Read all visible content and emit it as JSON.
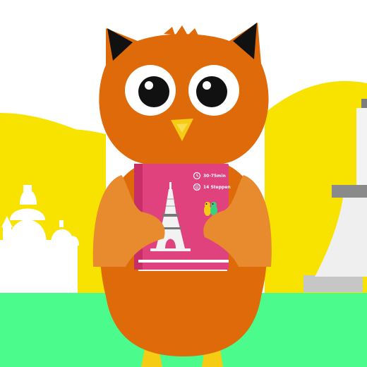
{
  "colors": {
    "sky": "#ffffff",
    "hills": "#f8e200",
    "ground": "#4bfc8c",
    "owl_body": "#de6a09",
    "owl_wing": "#e88a2e",
    "book": "#e0427e",
    "beak": "#f6cb14"
  },
  "book": {
    "duration": "30-75min",
    "steps": "14 Steppen"
  },
  "icons": [
    "clock-icon",
    "list-icon",
    "eiffel-tower-icon",
    "characters-icon"
  ]
}
